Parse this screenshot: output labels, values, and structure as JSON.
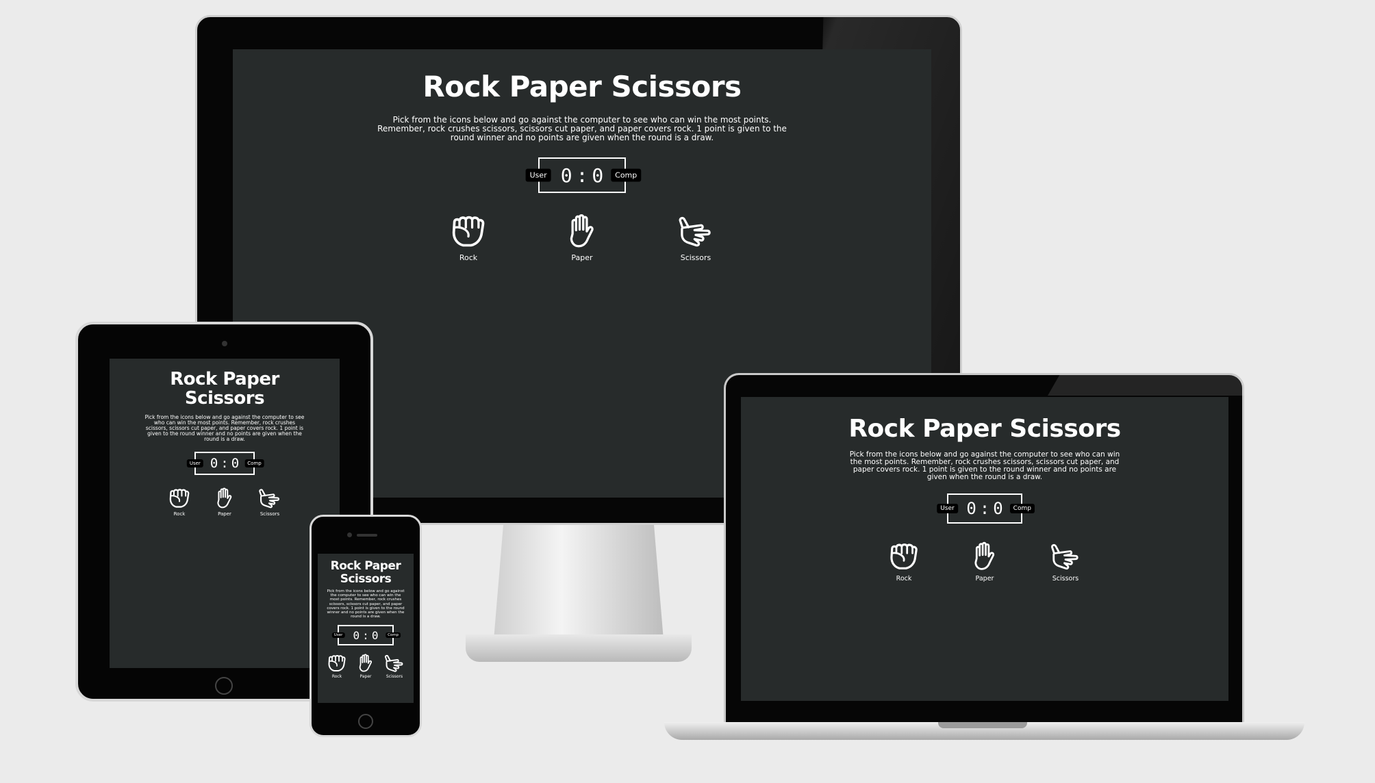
{
  "app": {
    "title": "Rock Paper Scissors",
    "description": "Pick from the icons below and go against the computer to see who can win the most points. Remember, rock crushes scissors, scissors cut paper, and paper covers rock. 1 point is given to the round winner and no points are given when the round is a draw.",
    "score": {
      "user_label": "User",
      "comp_label": "Comp",
      "user_score": "0",
      "separator": ":",
      "comp_score": "0"
    },
    "choices": [
      {
        "label": "Rock",
        "icon": "rock-hand-icon"
      },
      {
        "label": "Paper",
        "icon": "paper-hand-icon"
      },
      {
        "label": "Scissors",
        "icon": "scissors-hand-icon"
      }
    ]
  },
  "colors": {
    "page_background": "#ebebeb",
    "screen_background": "#272b2b",
    "device_bezel": "#0a0a0a",
    "text": "#ffffff",
    "badge": "#000000"
  }
}
